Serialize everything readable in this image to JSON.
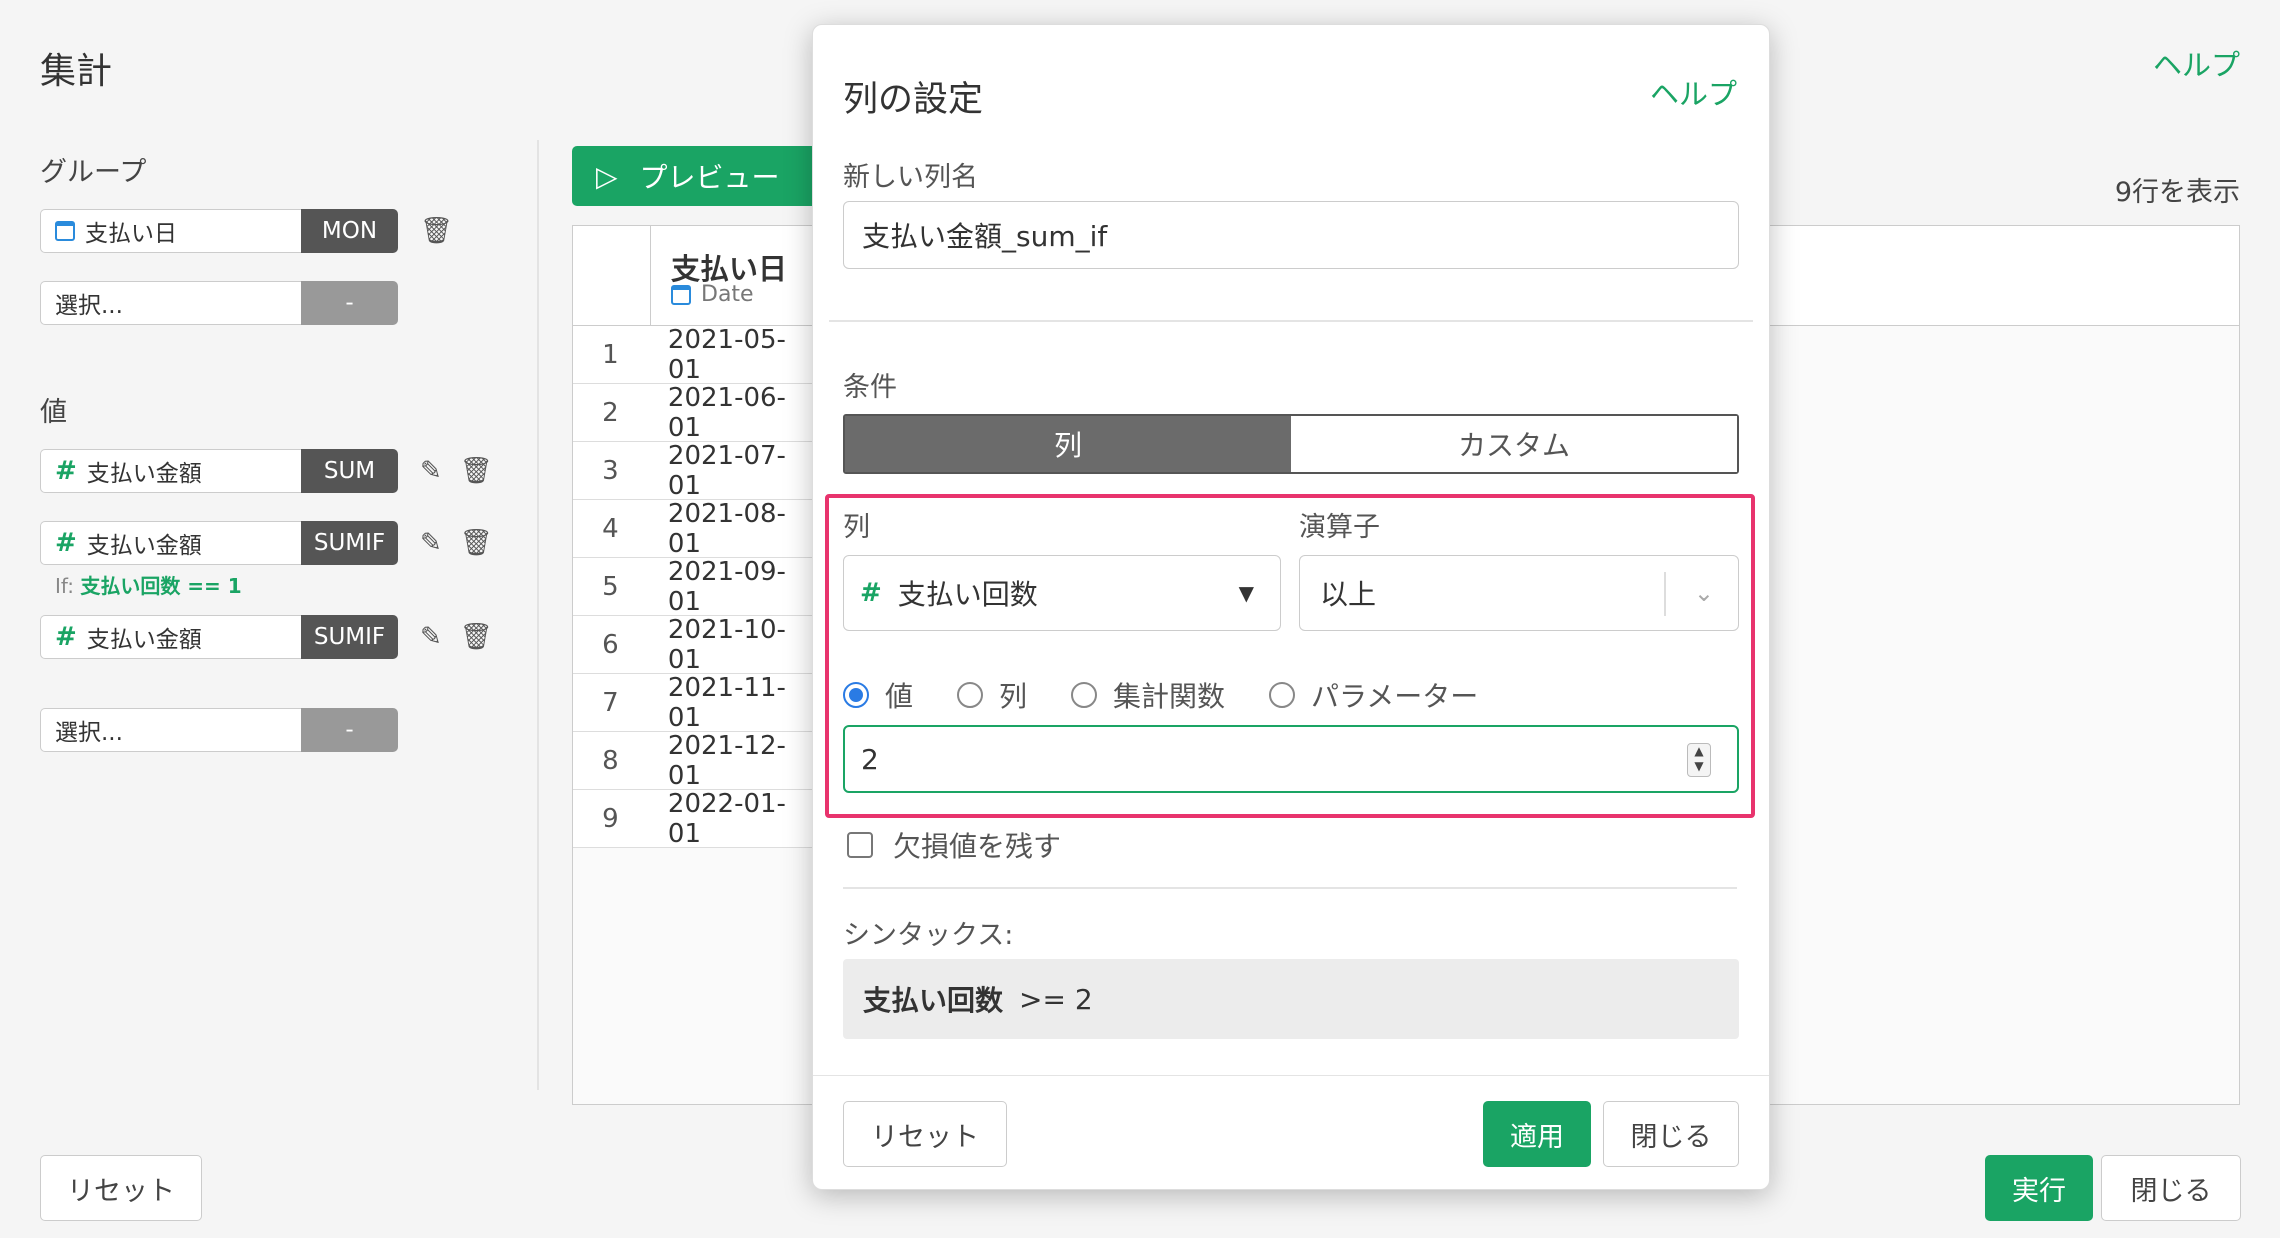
{
  "page": {
    "title": "集計",
    "help": "ヘルプ",
    "rows_info": "9行を表示"
  },
  "group": {
    "label": "グループ",
    "fields": [
      {
        "name": "支払い日",
        "tag": "MON"
      },
      {
        "name": "選択...",
        "tag": "-"
      }
    ]
  },
  "values": {
    "label": "値",
    "fields": [
      {
        "name": "支払い金額",
        "tag": "SUM"
      },
      {
        "name": "支払い金額",
        "tag": "SUMIF"
      },
      {
        "name": "支払い金額",
        "tag": "SUMIF"
      },
      {
        "name": "選択...",
        "tag": "-"
      }
    ],
    "if_prefix": "If:",
    "if_condition": "支払い回数 == 1"
  },
  "preview": {
    "button_label": "プレビュー",
    "column_title": "支払い日",
    "column_type": "Date",
    "rows": [
      {
        "n": "1",
        "v": "2021-05-01"
      },
      {
        "n": "2",
        "v": "2021-06-01"
      },
      {
        "n": "3",
        "v": "2021-07-01"
      },
      {
        "n": "4",
        "v": "2021-08-01"
      },
      {
        "n": "5",
        "v": "2021-09-01"
      },
      {
        "n": "6",
        "v": "2021-10-01"
      },
      {
        "n": "7",
        "v": "2021-11-01"
      },
      {
        "n": "8",
        "v": "2021-12-01"
      },
      {
        "n": "9",
        "v": "2022-01-01"
      }
    ]
  },
  "footer": {
    "reset": "リセット",
    "run": "実行",
    "close": "閉じる"
  },
  "modal": {
    "title": "列の設定",
    "help": "ヘルプ",
    "new_column_label": "新しい列名",
    "new_column_value": "支払い金額_sum_if",
    "condition_label": "条件",
    "mode_tabs": [
      "列",
      "カスタム"
    ],
    "column_label": "列",
    "column_value": "支払い回数",
    "operator_label": "演算子",
    "operator_value": "以上",
    "radio_options": [
      "値",
      "列",
      "集計関数",
      "パラメーター"
    ],
    "value_input": "2",
    "keep_na_label": "欠損値を残す",
    "syntax_label": "シンタックス:",
    "syntax_column": "支払い回数",
    "syntax_rest": ">=  2",
    "reset": "リセット",
    "apply": "適用",
    "close": "閉じる"
  },
  "colors": {
    "accent": "#1aa464",
    "highlight": "#e8336d",
    "tag": "#555555",
    "radio": "#2a7be4"
  }
}
